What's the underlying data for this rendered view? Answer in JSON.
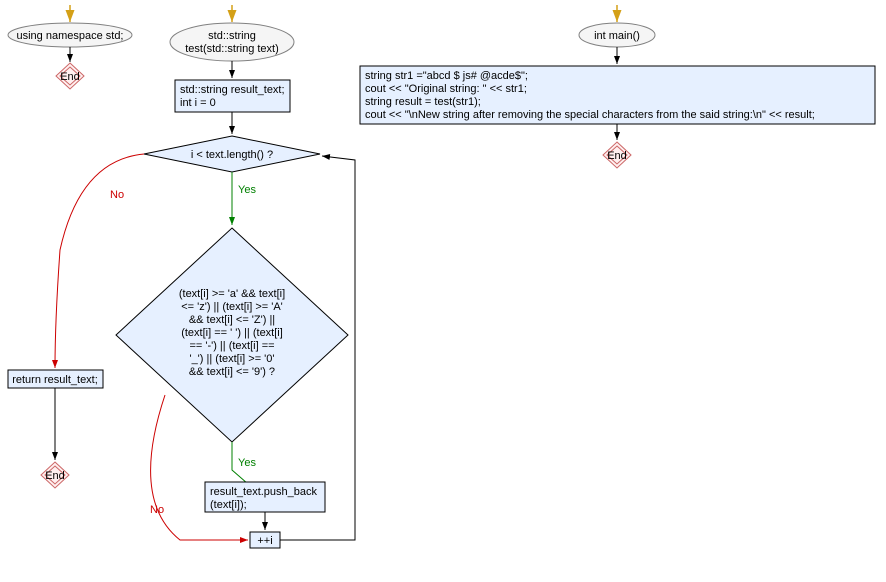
{
  "flowchart1": {
    "start_arrow": true,
    "node1": "using namespace std;",
    "end1": "End"
  },
  "flowchart2": {
    "start_arrow": true,
    "terminal_start": "std::string\ntest(std::string text)",
    "process1": "std::string result_text;\nint i = 0",
    "decision1": "i < text.length() ?",
    "decision1_yes": "Yes",
    "decision1_no": "No",
    "decision2": "(text[i] >= 'a' && text[i]\n<= 'z') || (text[i] >= 'A'\n&& text[i] <= 'Z') ||\n(text[i] == ' ') || (text[i]\n== '-') || (text[i] ==\n'_') || (text[i] >= '0'\n&& text[i] <= '9') ?",
    "decision2_yes": "Yes",
    "decision2_no": "No",
    "process_return": "return result_text;",
    "process_push": "result_text.push_back\n(text[i]);",
    "process_inc": "++i",
    "end_left": "End"
  },
  "flowchart3": {
    "start_arrow": true,
    "terminal_start": "int main()",
    "code_block": "string str1 =\"abcd $ js# @acde$\";\ncout << \"Original string: \" << str1;\nstring result = test(str1);\ncout << \"\\nNew string after removing the special characters from the said string:\\n\" << result;",
    "end": "End"
  },
  "colors": {
    "arrow_gold": "#d4a017",
    "border_black": "#000000",
    "border_gray": "#808080",
    "fill_ellipse": "#f5f5f5",
    "fill_lightblue": "#e6f0ff",
    "edge_yes": "#008000",
    "edge_no": "#cc0000",
    "edge_black": "#000000",
    "end_fill": "#ffe0e0",
    "end_border": "#cc6666"
  }
}
